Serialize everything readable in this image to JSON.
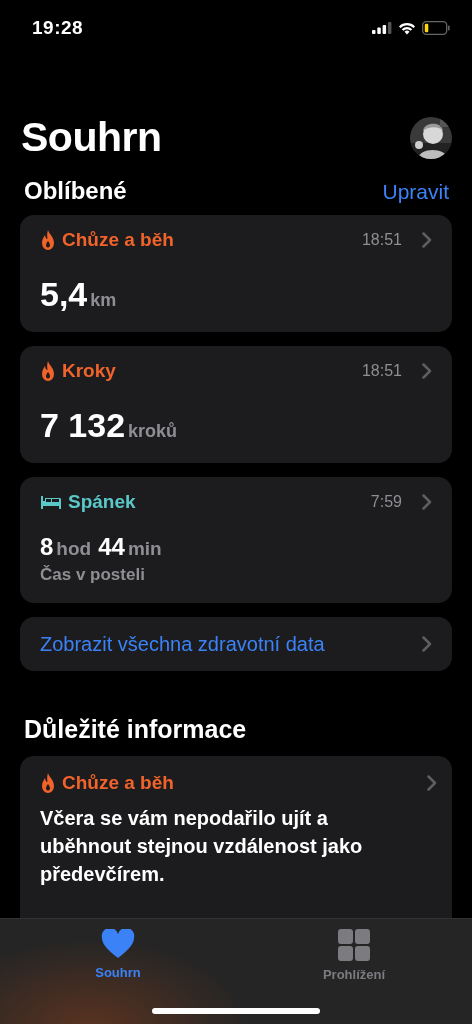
{
  "status_bar": {
    "time": "19:28"
  },
  "header": {
    "title": "Souhrn"
  },
  "favorites": {
    "title": "Oblíbené",
    "edit": "Upravit",
    "cards": [
      {
        "kind": "flame",
        "color": "#f0632a",
        "title": "Chůze a běh",
        "time": "18:51",
        "value": [
          {
            "number": "5,4",
            "unit": "km"
          }
        ]
      },
      {
        "kind": "flame",
        "color": "#f0632a",
        "title": "Kroky",
        "time": "18:51",
        "value": [
          {
            "number": "7 132",
            "unit": "kroků"
          }
        ]
      },
      {
        "kind": "bed",
        "color": "#5ac8c8",
        "title": "Spánek",
        "time": "7:59",
        "value": [
          {
            "number": "8",
            "unit": "hod"
          },
          {
            "number": "44",
            "unit": "min"
          }
        ],
        "note": "Čas v posteli"
      }
    ],
    "show_all": "Zobrazit všechna zdravotní data"
  },
  "highlights": {
    "title": "Důležité informace",
    "cards": [
      {
        "kind": "flame",
        "color": "#f0632a",
        "title": "Chůze a běh",
        "text": "Včera se vám nepodařilo ujít a uběhnout stejnou vzdálenost jako předevčírem."
      }
    ]
  },
  "tabs": [
    {
      "kind": "heart",
      "label": "Souhrn",
      "selected": true
    },
    {
      "kind": "grid",
      "label": "Prohlížení",
      "selected": false
    }
  ]
}
